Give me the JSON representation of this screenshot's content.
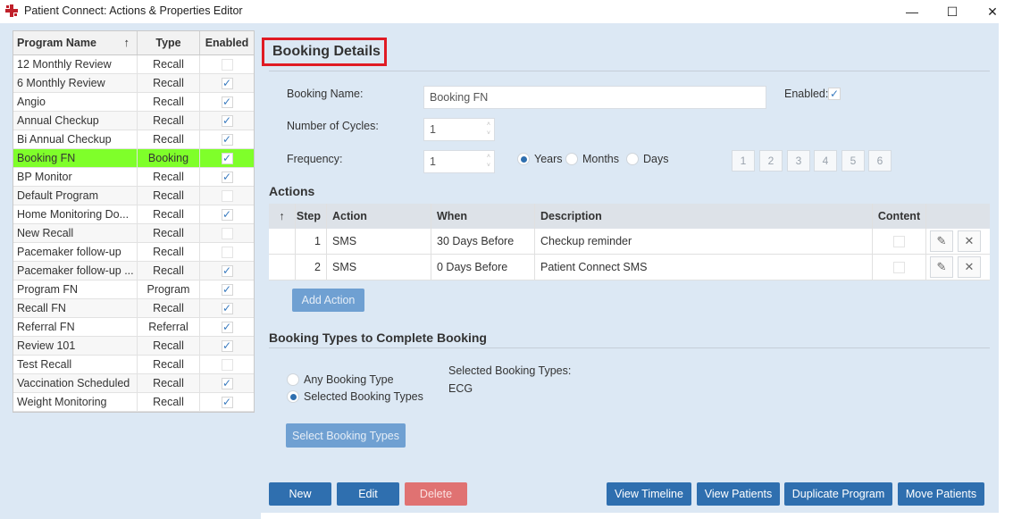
{
  "window": {
    "title": "Patient Connect: Actions & Properties Editor",
    "minimize": "—",
    "maximize": "☐",
    "close": "✕"
  },
  "program_list": {
    "headers": {
      "name": "Program Name",
      "type": "Type",
      "enabled": "Enabled",
      "sort_arrow": "↑"
    },
    "rows": [
      {
        "name": "12 Monthly Review",
        "type": "Recall",
        "enabled": ""
      },
      {
        "name": "6 Monthly Review",
        "type": "Recall",
        "enabled": "✓"
      },
      {
        "name": "Angio",
        "type": "Recall",
        "enabled": "✓"
      },
      {
        "name": "Annual Checkup",
        "type": "Recall",
        "enabled": "✓"
      },
      {
        "name": "Bi Annual Checkup",
        "type": "Recall",
        "enabled": "✓"
      },
      {
        "name": "Booking FN",
        "type": "Booking",
        "enabled": "✓"
      },
      {
        "name": "BP Monitor",
        "type": "Recall",
        "enabled": "✓"
      },
      {
        "name": "Default Program",
        "type": "Recall",
        "enabled": ""
      },
      {
        "name": "Home Monitoring Do...",
        "type": "Recall",
        "enabled": "✓"
      },
      {
        "name": "New Recall",
        "type": "Recall",
        "enabled": ""
      },
      {
        "name": "Pacemaker follow-up",
        "type": "Recall",
        "enabled": ""
      },
      {
        "name": "Pacemaker follow-up ...",
        "type": "Recall",
        "enabled": "✓"
      },
      {
        "name": "Program FN",
        "type": "Program",
        "enabled": "✓"
      },
      {
        "name": "Recall FN",
        "type": "Recall",
        "enabled": "✓"
      },
      {
        "name": "Referral FN",
        "type": "Referral",
        "enabled": "✓"
      },
      {
        "name": "Review 101",
        "type": "Recall",
        "enabled": "✓"
      },
      {
        "name": "Test Recall",
        "type": "Recall",
        "enabled": ""
      },
      {
        "name": "Vaccination Scheduled",
        "type": "Recall",
        "enabled": "✓"
      },
      {
        "name": "Weight Monitoring",
        "type": "Recall",
        "enabled": "✓"
      }
    ],
    "selected_index": 5,
    "selected_color": "#7fff2a"
  },
  "details": {
    "heading": "Booking Details",
    "booking_name_label": "Booking Name:",
    "booking_name_value": "Booking FN",
    "enabled_label": "Enabled:",
    "enabled_mark": "✓",
    "cycles_label": "Number of Cycles:",
    "cycles_value": "1",
    "frequency_label": "Frequency:",
    "frequency_value": "1",
    "freq_options": [
      "Years",
      "Months",
      "Days"
    ],
    "freq_selected": "Years",
    "number_buttons": [
      "1",
      "2",
      "3",
      "4",
      "5",
      "6"
    ],
    "spin_up": "˄",
    "spin_down": "˅"
  },
  "actions": {
    "heading": "Actions",
    "headers": {
      "arrow": "↑",
      "step": "Step",
      "action": "Action",
      "when": "When",
      "description": "Description",
      "content": "Content"
    },
    "rows": [
      {
        "step": "1",
        "action": "SMS",
        "when": "30 Days Before",
        "description": "Checkup reminder"
      },
      {
        "step": "2",
        "action": "SMS",
        "when": "0 Days Before",
        "description": "Patient Connect SMS"
      }
    ],
    "edit_icon": "✎",
    "delete_icon": "✕",
    "add_button": "Add Action"
  },
  "booking_types": {
    "heading": "Booking Types to Complete Booking",
    "option_any": "Any Booking Type",
    "option_selected": "Selected Booking Types",
    "selected_label": "Selected Booking Types:",
    "selected_value": "ECG",
    "select_button": "Select Booking Types"
  },
  "footer": {
    "new": "New",
    "edit": "Edit",
    "delete": "Delete",
    "view_timeline": "View Timeline",
    "view_patients": "View Patients",
    "duplicate_program": "Duplicate Program",
    "move_patients": "Move Patients"
  },
  "colors": {
    "panel_bg": "#dce8f4",
    "primary_button": "#2f6faf",
    "highlight_border": "#e01b24",
    "app_icon": "#c0202a"
  }
}
